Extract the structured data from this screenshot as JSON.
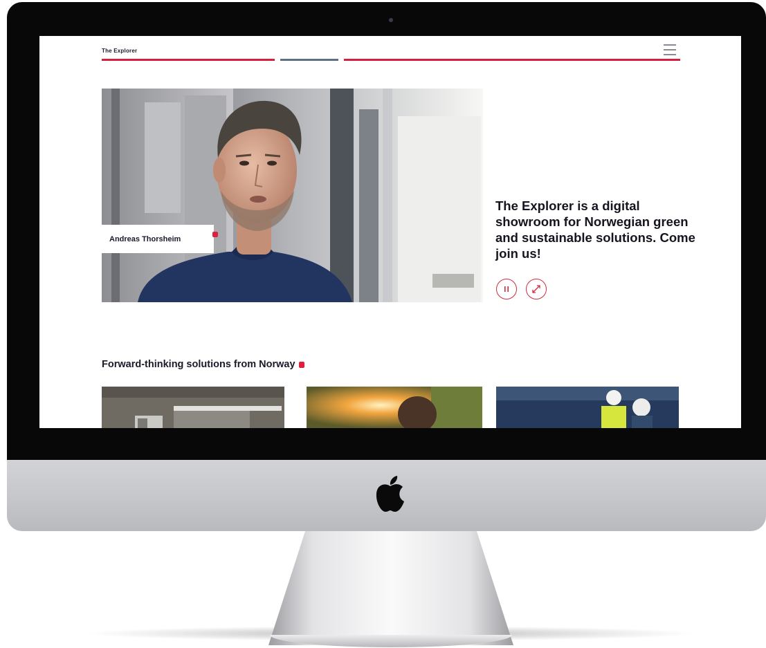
{
  "site": {
    "brand": "The Explorer",
    "menu_icon": "hamburger-icon",
    "accent_color": "#d6203b",
    "secondary_color": "#5c6f86"
  },
  "hero": {
    "person_name": "Andreas Thorsheim",
    "tagline": "The Explorer is a digital showroom for Norwegian green and sustainable solutions. Come join us!",
    "controls": [
      {
        "name": "pause",
        "icon": "pause-icon"
      },
      {
        "name": "fullscreen",
        "icon": "expand-icon"
      }
    ]
  },
  "solutions": {
    "title": "Forward-thinking solutions from Norway",
    "cards": [
      {
        "image": "building-facade-image"
      },
      {
        "image": "sunset-forest-image"
      },
      {
        "image": "engineers-solar-panels-image"
      }
    ]
  },
  "device": {
    "logo": "apple-icon"
  }
}
